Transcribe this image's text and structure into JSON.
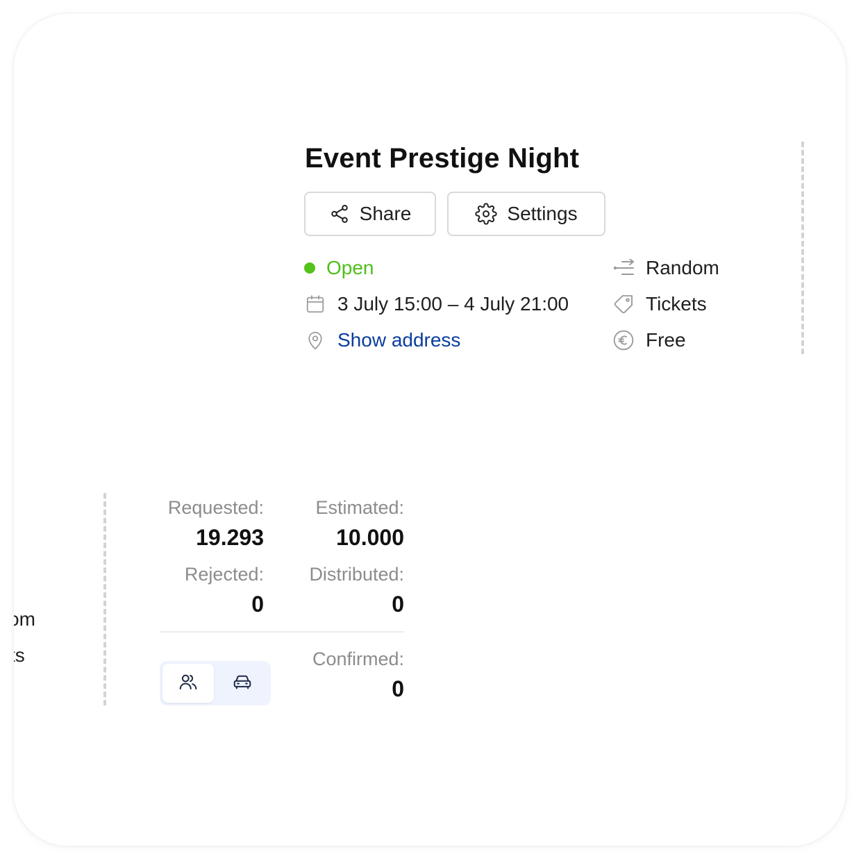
{
  "event": {
    "title": "Event Prestige Night",
    "share_label": "Share",
    "settings_label": "Settings",
    "status": "Open",
    "status_color": "#55c21b",
    "date_range": "3 July 15:00 – 4 July 21:00",
    "address_link": "Show address",
    "link_color": "#0a3d9e",
    "allocation": "Random",
    "type": "Tickets",
    "price": "Free"
  },
  "stats": {
    "requested_label": "Requested:",
    "requested_value": "19.293",
    "estimated_label": "Estimated:",
    "estimated_value": "10.000",
    "rejected_label": "Rejected:",
    "rejected_value": "0",
    "distributed_label": "Distributed:",
    "distributed_value": "0",
    "confirmed_label": "Confirmed:",
    "confirmed_value": "0"
  },
  "toggle": {
    "options": [
      "persons-icon",
      "car-icon"
    ],
    "active": "persons-icon"
  },
  "clipped_left": {
    "line1": "om",
    "line2": "ts"
  }
}
